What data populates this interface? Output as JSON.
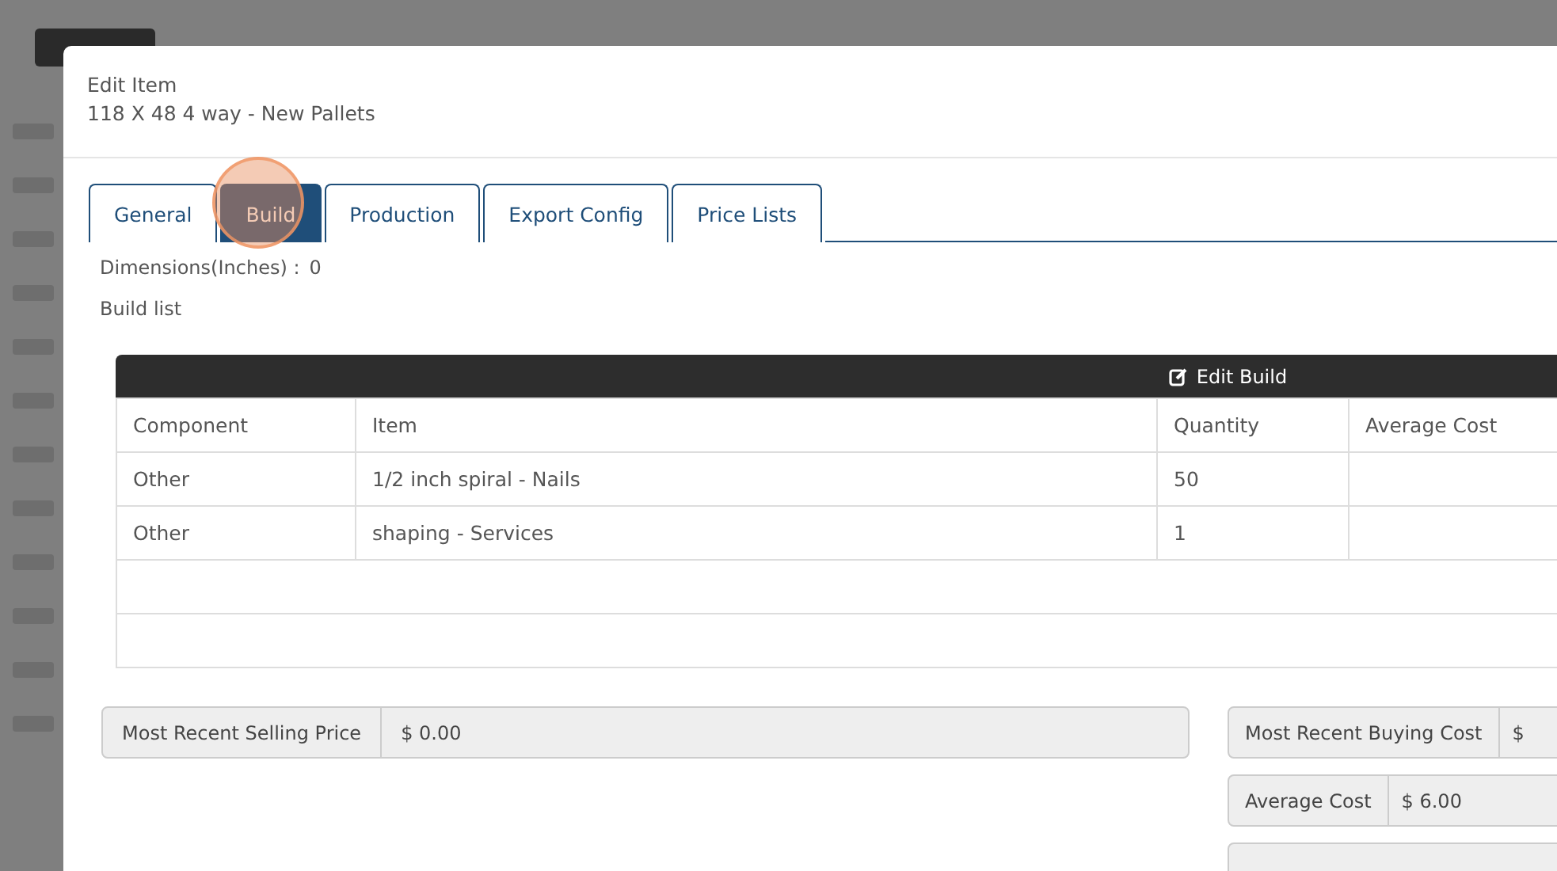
{
  "modal": {
    "title": "Edit Item",
    "subtitle": "118 X 48 4 way - New Pallets"
  },
  "tabs": [
    {
      "label": "General",
      "selected": false
    },
    {
      "label": "Build",
      "selected": true
    },
    {
      "label": "Production",
      "selected": false
    },
    {
      "label": "Export Config",
      "selected": false
    },
    {
      "label": "Price Lists",
      "selected": false
    }
  ],
  "dimensions": {
    "label": "Dimensions(Inches) :",
    "value": "0"
  },
  "build_list_label": "Build list",
  "edit_build_button": "Edit Build",
  "table": {
    "columns": [
      "Component",
      "Item",
      "Quantity",
      "Average Cost"
    ],
    "rows": [
      [
        "Other",
        "1/2 inch spiral - Nails",
        "50",
        ""
      ],
      [
        "Other",
        "shaping - Services",
        "1",
        ""
      ]
    ]
  },
  "price_left": [
    {
      "label": "Most Recent Selling Price",
      "value": "$ 0.00"
    }
  ],
  "price_right": [
    {
      "label": "Most Recent Buying Cost",
      "value": "$"
    },
    {
      "label": "Average Cost",
      "value": "$ 6.00"
    }
  ]
}
